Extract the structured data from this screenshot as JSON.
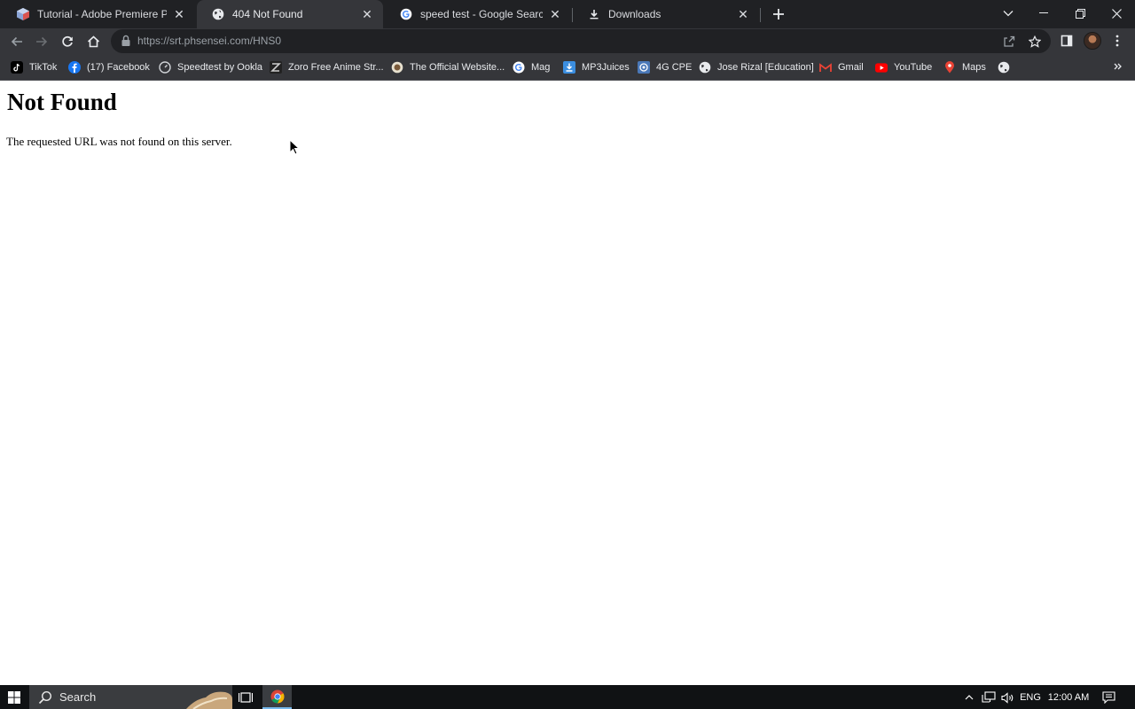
{
  "browser": {
    "tabs": [
      {
        "title": "Tutorial - Adobe Premiere Pro CC",
        "favicon": "premiere-cube-icon",
        "active": false
      },
      {
        "title": "404 Not Found",
        "favicon": "globe-icon",
        "active": true
      },
      {
        "title": "speed test - Google Search",
        "favicon": "google-g-icon",
        "active": false
      },
      {
        "title": "Downloads",
        "favicon": "download-icon",
        "active": false
      }
    ],
    "url_host": "https://srt.phsensei.com",
    "url_path": "/HNS0",
    "bookmarks": [
      {
        "label": "TikTok",
        "icon": "tiktok-icon"
      },
      {
        "label": "(17) Facebook",
        "icon": "facebook-icon"
      },
      {
        "label": "Speedtest by Ookla",
        "icon": "speedtest-icon"
      },
      {
        "label": "Zoro Free Anime Str...",
        "icon": "zoro-icon"
      },
      {
        "label": "The Official Website...",
        "icon": "seal-icon"
      },
      {
        "label": "Mag",
        "icon": "google-g-icon"
      },
      {
        "label": "MP3Juices",
        "icon": "mp3juices-icon"
      },
      {
        "label": "4G CPE",
        "icon": "router-icon"
      },
      {
        "label": "Jose Rizal [Education]",
        "icon": "globe-icon"
      },
      {
        "label": "Gmail",
        "icon": "gmail-icon"
      },
      {
        "label": "YouTube",
        "icon": "youtube-icon"
      },
      {
        "label": "Maps",
        "icon": "maps-icon"
      }
    ]
  },
  "page": {
    "heading": "Not Found",
    "message": "The requested URL was not found on this server."
  },
  "taskbar": {
    "search_label": "Search",
    "language": "ENG",
    "time": "12:00 AM"
  },
  "colors": {
    "tabstrip_bg": "#202124",
    "toolbar_bg": "#35363a",
    "taskbar_bg": "#101214",
    "accent": "#76b9ed"
  }
}
